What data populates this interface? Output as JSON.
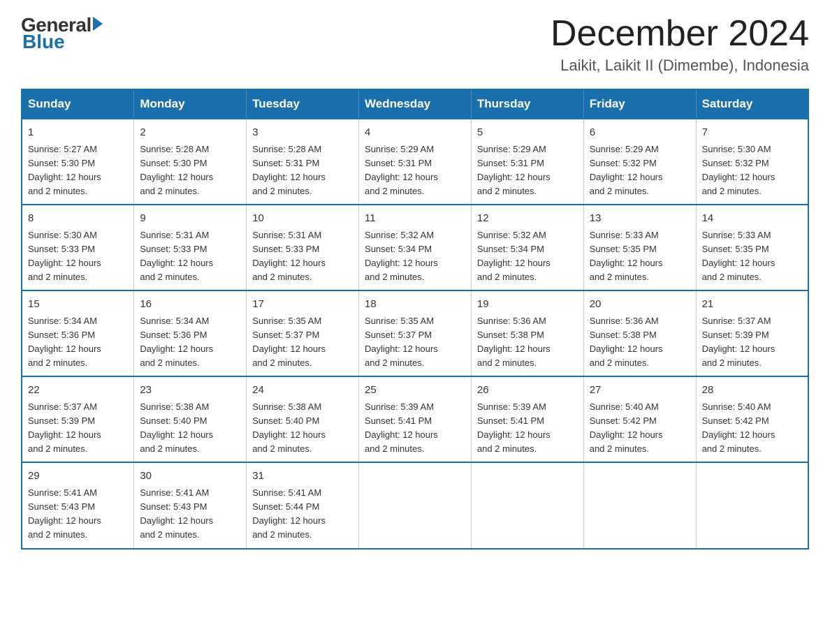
{
  "logo": {
    "general": "General",
    "blue": "Blue"
  },
  "title": {
    "month": "December 2024",
    "location": "Laikit, Laikit II (Dimembe), Indonesia"
  },
  "header": {
    "days": [
      "Sunday",
      "Monday",
      "Tuesday",
      "Wednesday",
      "Thursday",
      "Friday",
      "Saturday"
    ]
  },
  "weeks": [
    {
      "days": [
        {
          "num": "1",
          "info": "Sunrise: 5:27 AM\nSunset: 5:30 PM\nDaylight: 12 hours\nand 2 minutes."
        },
        {
          "num": "2",
          "info": "Sunrise: 5:28 AM\nSunset: 5:30 PM\nDaylight: 12 hours\nand 2 minutes."
        },
        {
          "num": "3",
          "info": "Sunrise: 5:28 AM\nSunset: 5:31 PM\nDaylight: 12 hours\nand 2 minutes."
        },
        {
          "num": "4",
          "info": "Sunrise: 5:29 AM\nSunset: 5:31 PM\nDaylight: 12 hours\nand 2 minutes."
        },
        {
          "num": "5",
          "info": "Sunrise: 5:29 AM\nSunset: 5:31 PM\nDaylight: 12 hours\nand 2 minutes."
        },
        {
          "num": "6",
          "info": "Sunrise: 5:29 AM\nSunset: 5:32 PM\nDaylight: 12 hours\nand 2 minutes."
        },
        {
          "num": "7",
          "info": "Sunrise: 5:30 AM\nSunset: 5:32 PM\nDaylight: 12 hours\nand 2 minutes."
        }
      ]
    },
    {
      "days": [
        {
          "num": "8",
          "info": "Sunrise: 5:30 AM\nSunset: 5:33 PM\nDaylight: 12 hours\nand 2 minutes."
        },
        {
          "num": "9",
          "info": "Sunrise: 5:31 AM\nSunset: 5:33 PM\nDaylight: 12 hours\nand 2 minutes."
        },
        {
          "num": "10",
          "info": "Sunrise: 5:31 AM\nSunset: 5:33 PM\nDaylight: 12 hours\nand 2 minutes."
        },
        {
          "num": "11",
          "info": "Sunrise: 5:32 AM\nSunset: 5:34 PM\nDaylight: 12 hours\nand 2 minutes."
        },
        {
          "num": "12",
          "info": "Sunrise: 5:32 AM\nSunset: 5:34 PM\nDaylight: 12 hours\nand 2 minutes."
        },
        {
          "num": "13",
          "info": "Sunrise: 5:33 AM\nSunset: 5:35 PM\nDaylight: 12 hours\nand 2 minutes."
        },
        {
          "num": "14",
          "info": "Sunrise: 5:33 AM\nSunset: 5:35 PM\nDaylight: 12 hours\nand 2 minutes."
        }
      ]
    },
    {
      "days": [
        {
          "num": "15",
          "info": "Sunrise: 5:34 AM\nSunset: 5:36 PM\nDaylight: 12 hours\nand 2 minutes."
        },
        {
          "num": "16",
          "info": "Sunrise: 5:34 AM\nSunset: 5:36 PM\nDaylight: 12 hours\nand 2 minutes."
        },
        {
          "num": "17",
          "info": "Sunrise: 5:35 AM\nSunset: 5:37 PM\nDaylight: 12 hours\nand 2 minutes."
        },
        {
          "num": "18",
          "info": "Sunrise: 5:35 AM\nSunset: 5:37 PM\nDaylight: 12 hours\nand 2 minutes."
        },
        {
          "num": "19",
          "info": "Sunrise: 5:36 AM\nSunset: 5:38 PM\nDaylight: 12 hours\nand 2 minutes."
        },
        {
          "num": "20",
          "info": "Sunrise: 5:36 AM\nSunset: 5:38 PM\nDaylight: 12 hours\nand 2 minutes."
        },
        {
          "num": "21",
          "info": "Sunrise: 5:37 AM\nSunset: 5:39 PM\nDaylight: 12 hours\nand 2 minutes."
        }
      ]
    },
    {
      "days": [
        {
          "num": "22",
          "info": "Sunrise: 5:37 AM\nSunset: 5:39 PM\nDaylight: 12 hours\nand 2 minutes."
        },
        {
          "num": "23",
          "info": "Sunrise: 5:38 AM\nSunset: 5:40 PM\nDaylight: 12 hours\nand 2 minutes."
        },
        {
          "num": "24",
          "info": "Sunrise: 5:38 AM\nSunset: 5:40 PM\nDaylight: 12 hours\nand 2 minutes."
        },
        {
          "num": "25",
          "info": "Sunrise: 5:39 AM\nSunset: 5:41 PM\nDaylight: 12 hours\nand 2 minutes."
        },
        {
          "num": "26",
          "info": "Sunrise: 5:39 AM\nSunset: 5:41 PM\nDaylight: 12 hours\nand 2 minutes."
        },
        {
          "num": "27",
          "info": "Sunrise: 5:40 AM\nSunset: 5:42 PM\nDaylight: 12 hours\nand 2 minutes."
        },
        {
          "num": "28",
          "info": "Sunrise: 5:40 AM\nSunset: 5:42 PM\nDaylight: 12 hours\nand 2 minutes."
        }
      ]
    },
    {
      "days": [
        {
          "num": "29",
          "info": "Sunrise: 5:41 AM\nSunset: 5:43 PM\nDaylight: 12 hours\nand 2 minutes."
        },
        {
          "num": "30",
          "info": "Sunrise: 5:41 AM\nSunset: 5:43 PM\nDaylight: 12 hours\nand 2 minutes."
        },
        {
          "num": "31",
          "info": "Sunrise: 5:41 AM\nSunset: 5:44 PM\nDaylight: 12 hours\nand 2 minutes."
        },
        {
          "num": "",
          "info": ""
        },
        {
          "num": "",
          "info": ""
        },
        {
          "num": "",
          "info": ""
        },
        {
          "num": "",
          "info": ""
        }
      ]
    }
  ]
}
